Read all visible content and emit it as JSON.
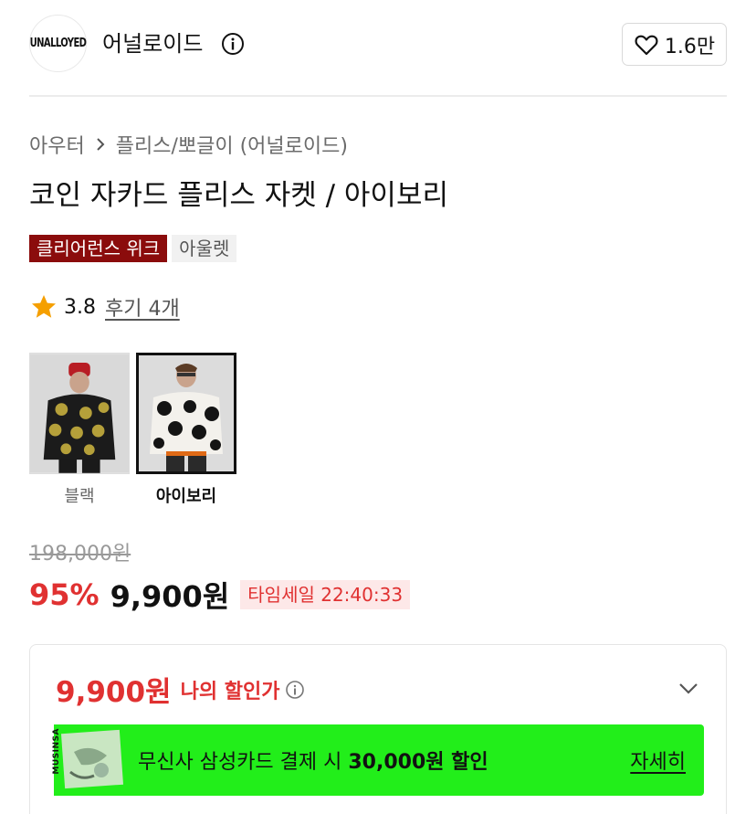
{
  "brand": {
    "logo_text": "UNALLOYED",
    "name": "어널로이드",
    "like_count": "1.6만"
  },
  "breadcrumb": {
    "category": "아우터",
    "subcategory": "플리스/뽀글이 (어널로이드)"
  },
  "product": {
    "title": "코인 자카드 플리스 자켓 / 아이보리",
    "tags": [
      "클리어런스 위크",
      "아울렛"
    ],
    "rating": "3.8",
    "review_link": "후기 4개"
  },
  "colors": [
    {
      "label": "블랙",
      "selected": false
    },
    {
      "label": "아이보리",
      "selected": true
    }
  ],
  "price": {
    "original": "198,000원",
    "discount_rate": "95%",
    "sale": "9,900원",
    "time_sale": "타임세일 22:40:33"
  },
  "benefit": {
    "my_price": "9,900원",
    "my_price_label": "나의 할인가",
    "promo_card_text": "MUSINSA",
    "promo_text_prefix": "무신사 삼성카드 결제 시 ",
    "promo_text_amount": "30,000원 할인",
    "promo_link": "자세히"
  },
  "colors_theme": {
    "sale_red": "#e03131",
    "tag_dark_red": "#8b0c0c",
    "promo_green": "#22ee1a",
    "star": "#f59f00"
  }
}
